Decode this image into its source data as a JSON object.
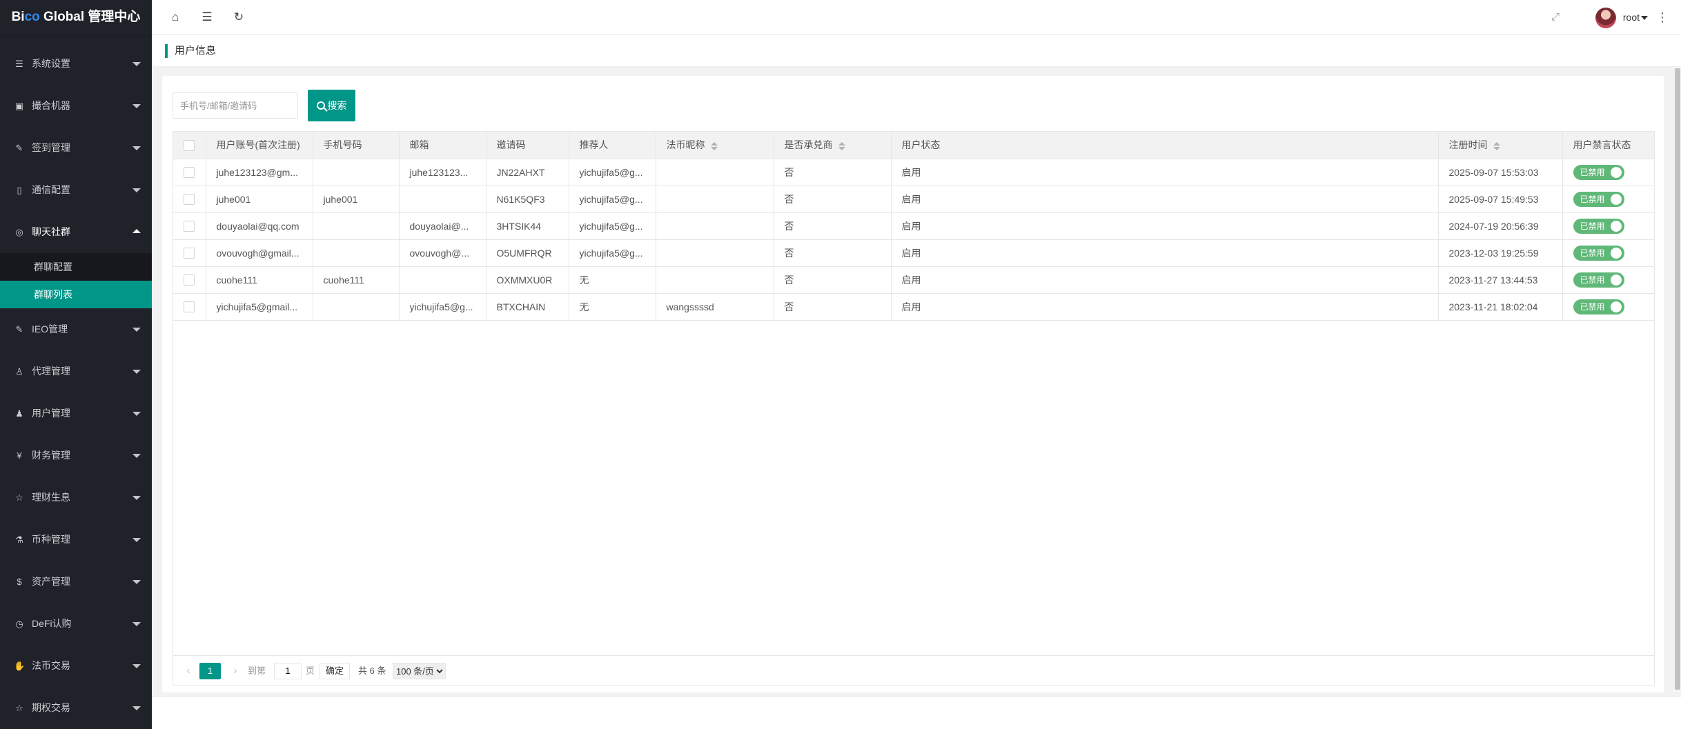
{
  "app": {
    "logo_a": "Bi",
    "logo_b": "co",
    "logo_c": " Global 管理中心"
  },
  "sidebar": {
    "items": [
      {
        "label": "系统设置",
        "icon": "sliders-icon"
      },
      {
        "label": "撮合机器",
        "icon": "robot-icon"
      },
      {
        "label": "签到管理",
        "icon": "edit-icon"
      },
      {
        "label": "通信配置",
        "icon": "phone-icon"
      },
      {
        "label": "聊天社群",
        "icon": "chat-icon"
      },
      {
        "label": "IEO管理",
        "icon": "edit-icon"
      },
      {
        "label": "代理管理",
        "icon": "user-icon"
      },
      {
        "label": "用户管理",
        "icon": "users-icon"
      },
      {
        "label": "财务管理",
        "icon": "yen-icon"
      },
      {
        "label": "理财生息",
        "icon": "star-icon"
      },
      {
        "label": "币种管理",
        "icon": "flask-icon"
      },
      {
        "label": "资产管理",
        "icon": "dollar-icon"
      },
      {
        "label": "DeFi认购",
        "icon": "clock-icon"
      },
      {
        "label": "法币交易",
        "icon": "hand-icon"
      },
      {
        "label": "期权交易",
        "icon": "star-icon"
      }
    ],
    "sub_items": [
      {
        "label": "群聊配置"
      },
      {
        "label": "群聊列表"
      }
    ]
  },
  "header": {
    "username": "root"
  },
  "tab": {
    "title": "用户信息"
  },
  "search": {
    "placeholder": "手机号/邮箱/邀请码",
    "value": "",
    "button": "搜索"
  },
  "table": {
    "columns": [
      "用户账号(首次注册)",
      "手机号码",
      "邮箱",
      "邀请码",
      "推荐人",
      "法币昵称",
      "是否承兑商",
      "用户状态",
      "注册时间",
      "用户禁言状态"
    ],
    "rows": [
      {
        "account": "juhe123123@gm...",
        "phone": "",
        "email": "juhe123123...",
        "invite": "JN22AHXT",
        "referrer": "yichujifa5@g...",
        "nickname": "",
        "acceptor": "否",
        "status": "启用",
        "time": "2025-09-07 15:53:03",
        "mute": "已禁用"
      },
      {
        "account": "juhe001",
        "phone": "juhe001",
        "email": "",
        "invite": "N61K5QF3",
        "referrer": "yichujifa5@g...",
        "nickname": "",
        "acceptor": "否",
        "status": "启用",
        "time": "2025-09-07 15:49:53",
        "mute": "已禁用"
      },
      {
        "account": "douyaolai@qq.com",
        "phone": "",
        "email": "douyaolai@...",
        "invite": "3HTSIK44",
        "referrer": "yichujifa5@g...",
        "nickname": "",
        "acceptor": "否",
        "status": "启用",
        "time": "2024-07-19 20:56:39",
        "mute": "已禁用"
      },
      {
        "account": "ovouvogh@gmail...",
        "phone": "",
        "email": "ovouvogh@...",
        "invite": "O5UMFRQR",
        "referrer": "yichujifa5@g...",
        "nickname": "",
        "acceptor": "否",
        "status": "启用",
        "time": "2023-12-03 19:25:59",
        "mute": "已禁用"
      },
      {
        "account": "cuohe111",
        "phone": "cuohe111",
        "email": "",
        "invite": "OXMMXU0R",
        "referrer": "无",
        "nickname": "",
        "acceptor": "否",
        "status": "启用",
        "time": "2023-11-27 13:44:53",
        "mute": "已禁用"
      },
      {
        "account": "yichujifa5@gmail...",
        "phone": "",
        "email": "yichujifa5@g...",
        "invite": "BTXCHAIN",
        "referrer": "无",
        "nickname": "wangssssd",
        "acceptor": "否",
        "status": "启用",
        "time": "2023-11-21 18:02:04",
        "mute": "已禁用"
      }
    ]
  },
  "pager": {
    "current": "1",
    "goto_label": "到第",
    "goto_value": "1",
    "page_unit": "页",
    "ok": "确定",
    "total": "共 6 条",
    "page_size": "100 条/页"
  },
  "colors": {
    "accent": "#009688",
    "sidebar_bg": "#20222a",
    "switch": "#5fb878"
  }
}
